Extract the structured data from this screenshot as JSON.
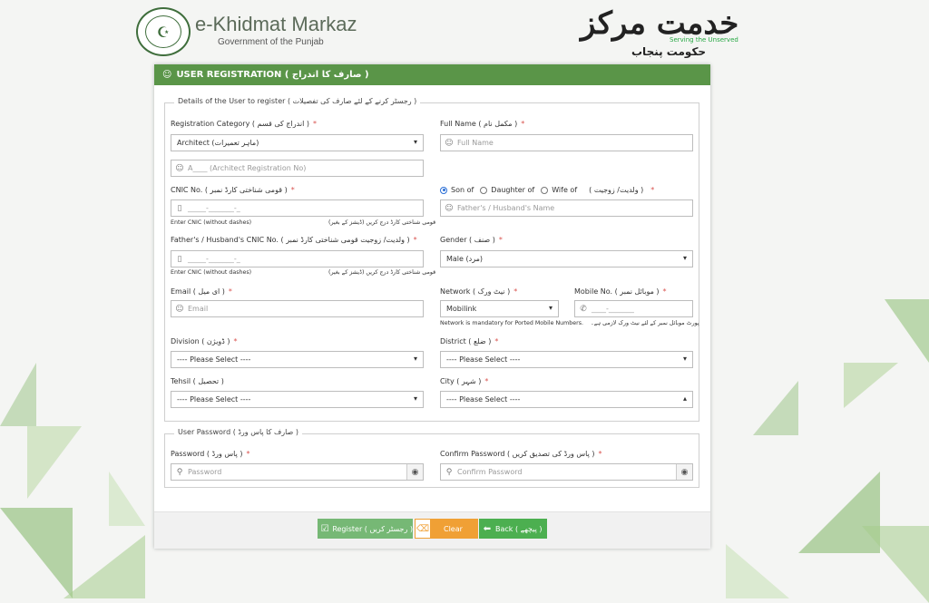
{
  "header": {
    "brand_title": "e-Khidmat Markaz",
    "brand_subtitle": "Government of the Punjab",
    "urdu_brand": "خدمت مرکز",
    "serving_tagline": "Serving the Unserved",
    "urdu_government": "حکومت پنجاب"
  },
  "card": {
    "title": "USER REGISTRATION ( صارف کا اندراج )"
  },
  "details": {
    "legend": "Details of the User to register ( رجسٹر کرنے کے لئے صارف کی تفصیلات )",
    "registration_category": {
      "label": "Registration Category ( اندراج کی قسم )",
      "value": "Architect (ماہر تعمیرات)"
    },
    "registration_no": {
      "placeholder": "A____ (Architect Registration No)"
    },
    "full_name": {
      "label": "Full Name ( مکمل نام )",
      "placeholder": "Full Name"
    },
    "cnic": {
      "label": "CNIC No. ( قومی شناختی کارڈ نمبر )",
      "placeholder": "_____-_______-_",
      "hint_en": "Enter CNIC (without dashes)",
      "hint_ur": "قومی شناختی کارڈ درج کریں (ڈیشز کے بغیر)"
    },
    "relation": {
      "options": [
        "Son of",
        "Daughter of",
        "Wife of"
      ],
      "selected": "Son of",
      "urdu_label": "( ولدیت/ زوجیت )",
      "placeholder": "Father's / Husband's Name"
    },
    "guardian_cnic": {
      "label": "Father's / Husband's CNIC No. ( ولدیت/ زوجیت قومی شناختی کارڈ نمبر )",
      "placeholder": "_____-_______-_",
      "hint_en": "Enter CNIC (without dashes)",
      "hint_ur": "قومی شناختی کارڈ درج کریں (ڈیشز کے بغیر)"
    },
    "gender": {
      "label": "Gender ( صنف )",
      "value": "Male (مرد)"
    },
    "email": {
      "label": "Email ( ای میل )",
      "placeholder": "Email"
    },
    "network": {
      "label": "Network ( نیٹ ورک )",
      "value": "Mobilink",
      "hint_en": "Network is mandatory for Ported Mobile Numbers.",
      "hint_ur": "پورٹ موبائل نمبر کے لئے نیٹ ورک لازمی ہے۔"
    },
    "mobile": {
      "label": "Mobile No. ( موبائل نمبر )",
      "placeholder": "____-_______"
    },
    "division": {
      "label": "Division ( ڈویژن )",
      "value": "---- Please Select ----"
    },
    "district": {
      "label": "District ( ضلع )",
      "value": "---- Please Select ----"
    },
    "tehsil": {
      "label": "Tehsil ( تحصیل )",
      "value": "---- Please Select ----"
    },
    "city": {
      "label": "City ( شہر )",
      "value": "---- Please Select ----"
    }
  },
  "password": {
    "legend": "User Password ( صارف کا پاس ورڈ )",
    "password": {
      "label": "Password ( پاس ورڈ )",
      "placeholder": "Password"
    },
    "confirm": {
      "label": "Confirm Password ( پاس ورڈ کی تصدیق کریں )",
      "placeholder": "Confirm Password"
    }
  },
  "buttons": {
    "register": "Register ( رجسٹر کریں )",
    "clear": "Clear",
    "back": "Back ( پیچھے )"
  },
  "colors": {
    "header_green": "#5a9548",
    "register_green": "#76b875",
    "clear_orange": "#f0a035",
    "back_green": "#4caf50",
    "required_red": "#d9534f"
  }
}
